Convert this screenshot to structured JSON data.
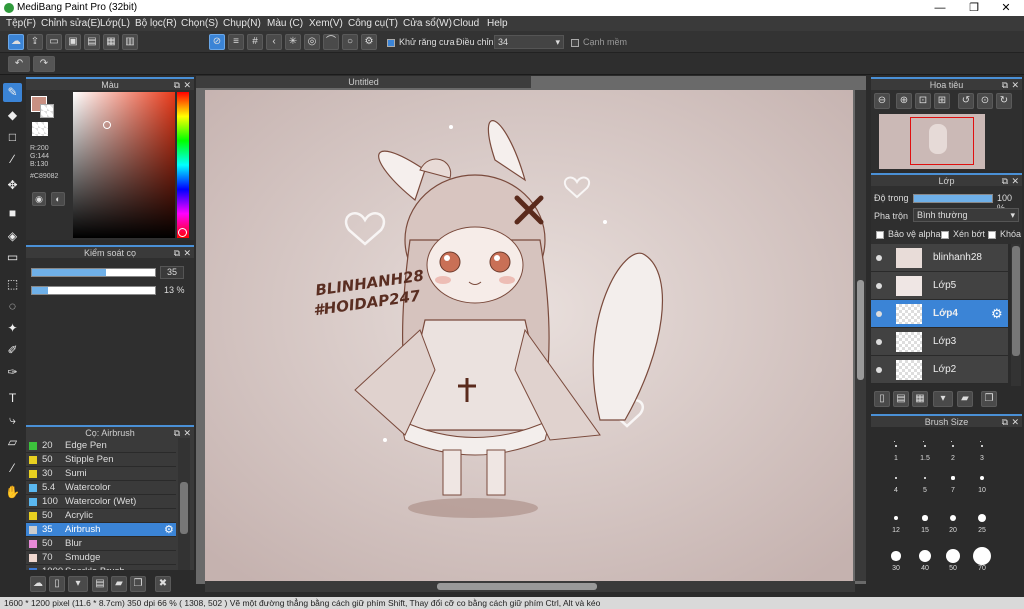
{
  "window": {
    "title": "MediBang Paint Pro (32bit)",
    "minimize": "—",
    "restore": "❐",
    "close": "✕"
  },
  "menu": [
    "Tệp(F)",
    "Chỉnh sửa(E)",
    "Lớp(L)",
    "Bộ lọc(R)",
    "Chọn(S)",
    "Chụp(N)",
    "Màu (C)",
    "Xem(V)",
    "Công cụ(T)",
    "Cửa sổ(W)",
    "Cloud",
    "Help"
  ],
  "toolbar": {
    "antialias_label": "Khử răng cưa",
    "adjust_label": "Điều chỉnh",
    "adjust_value": "34",
    "sharp_label": "Cạnh mềm"
  },
  "color_panel": {
    "title": "Màu",
    "r": "R:200",
    "g": "G:144",
    "b": "B:130",
    "hex": "#C89082",
    "fg_color": "#C89082"
  },
  "brush_control": {
    "title": "Kiểm soát cọ",
    "size_value": "35",
    "size_fraction": 0.6,
    "opacity_value": "13 %",
    "opacity_fraction": 0.13
  },
  "brush_list": {
    "title": "Cọ: Airbrush",
    "items": [
      {
        "size": "20",
        "name": "Edge Pen",
        "color": "#3cc23c"
      },
      {
        "size": "50",
        "name": "Stipple Pen",
        "color": "#e8d020"
      },
      {
        "size": "30",
        "name": "Sumi",
        "color": "#e8d020"
      },
      {
        "size": "5.4",
        "name": "Watercolor",
        "color": "#5ab8f0"
      },
      {
        "size": "100",
        "name": "Watercolor (Wet)",
        "color": "#5ab8f0"
      },
      {
        "size": "50",
        "name": "Acrylic",
        "color": "#e8d020"
      },
      {
        "size": "35",
        "name": "Airbrush",
        "color": "#cccccc"
      },
      {
        "size": "50",
        "name": "Blur",
        "color": "#e88ad8"
      },
      {
        "size": "70",
        "name": "Smudge",
        "color": "#f0d8d0"
      },
      {
        "size": "1000",
        "name": "Sparkle Brush",
        "color": "#3c7ad8"
      }
    ]
  },
  "canvas": {
    "tab_title": "Untitled",
    "watermark_line1": "BLINHANH28",
    "watermark_line2": "#HOIDAP247"
  },
  "navigator": {
    "title": "Hoa tiêu"
  },
  "layers_panel": {
    "title": "Lớp",
    "opacity_label": "Độ trong",
    "opacity_value": "100 %",
    "opacity_fraction": 1.0,
    "blend_label": "Pha trộn",
    "blend_value": "Bình thường",
    "protect_alpha": "Bảo vệ alpha",
    "clipping": "Xén bớt",
    "lock": "Khóa",
    "layers": [
      {
        "name": "blinhanh28"
      },
      {
        "name": "Lớp5"
      },
      {
        "name": "Lớp4"
      },
      {
        "name": "Lớp3"
      },
      {
        "name": "Lớp2"
      }
    ]
  },
  "brush_size_panel": {
    "title": "Brush Size",
    "sizes": [
      "1",
      "1.5",
      "2",
      "3",
      "4",
      "5",
      "7",
      "10",
      "12",
      "15",
      "20",
      "25",
      "30",
      "40",
      "50",
      "70"
    ]
  },
  "status": "1600 * 1200 pixel   (11.6 * 8.7cm)   350 dpi   66 %   ( 1308, 502 )   Vẽ một đường thẳng bằng cách giữ phím Shift, Thay đổi cỡ co bằng cách giữ phím Ctrl, Alt và kéo"
}
